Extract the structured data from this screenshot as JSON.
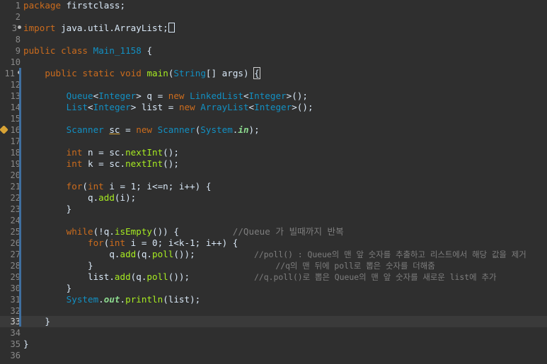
{
  "editor": {
    "language": "java",
    "cursor_line": 33,
    "lines": [
      {
        "num": "1",
        "text": "package firstclass;"
      },
      {
        "num": "2",
        "text": ""
      },
      {
        "num": "3",
        "text": "import java.util.ArrayList;"
      },
      {
        "num": "8",
        "text": ""
      },
      {
        "num": "9",
        "text": "public class Main_1158 {"
      },
      {
        "num": "10",
        "text": ""
      },
      {
        "num": "11",
        "text": "    public static void main(String[] args) {"
      },
      {
        "num": "12",
        "text": ""
      },
      {
        "num": "13",
        "text": "        Queue<Integer> q = new LinkedList<Integer>();"
      },
      {
        "num": "14",
        "text": "        List<Integer> list = new ArrayList<Integer>();"
      },
      {
        "num": "15",
        "text": ""
      },
      {
        "num": "16",
        "text": "        Scanner sc = new Scanner(System.in);"
      },
      {
        "num": "17",
        "text": ""
      },
      {
        "num": "18",
        "text": "        int n = sc.nextInt();"
      },
      {
        "num": "19",
        "text": "        int k = sc.nextInt();"
      },
      {
        "num": "20",
        "text": ""
      },
      {
        "num": "21",
        "text": "        for(int i = 1; i<=n; i++) {"
      },
      {
        "num": "22",
        "text": "            q.add(i);"
      },
      {
        "num": "23",
        "text": "        }"
      },
      {
        "num": "24",
        "text": ""
      },
      {
        "num": "25",
        "text": "        while(!q.isEmpty()) {          //Queue 가 빌때까지 반복"
      },
      {
        "num": "26",
        "text": "            for(int i = 0; i<k-1; i++) {"
      },
      {
        "num": "27",
        "text": "                q.add(q.poll());           //poll() : Queue의 맨 앞 숫자를 추출하고 리스트에서 해당 값을 제거"
      },
      {
        "num": "28",
        "text": "            }                                  //q의 맨 뒤에 poll로 뽑은 숫자를 더해줌"
      },
      {
        "num": "29",
        "text": "            list.add(q.poll());            //q.poll()로 뽑은 Queue의 맨 앞 숫자를 새로운 list에 추가"
      },
      {
        "num": "30",
        "text": "        }"
      },
      {
        "num": "31",
        "text": "        System.out.println(list);"
      },
      {
        "num": "32",
        "text": ""
      },
      {
        "num": "33",
        "text": "    }"
      },
      {
        "num": "34",
        "text": ""
      },
      {
        "num": "35",
        "text": "}"
      },
      {
        "num": "36",
        "text": ""
      }
    ]
  },
  "colors": {
    "background": "#2f2f2f",
    "current_line": "#3a3a3a",
    "keyword": "#cc6c1d",
    "type": "#1290c3",
    "comment": "#7e7e7e",
    "method": "#a7ec21",
    "static_field": "#8dda8f",
    "text": "#d9e8f7",
    "line_number": "#8a8a8a",
    "warning_marker": "#d8a335"
  }
}
